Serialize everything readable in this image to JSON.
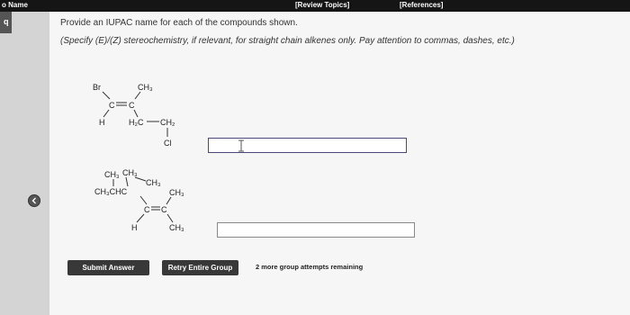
{
  "topbar": {
    "name_label": "o Name",
    "review_topics": "[Review Topics]",
    "references": "[References]"
  },
  "sidebar": {
    "question_tab": "q"
  },
  "instructions": {
    "line1": "Provide an IUPAC name for each of the compounds shown.",
    "line2": "(Specify (E)/(Z) stereochemistry, if relevant, for straight chain alkenes only. Pay attention to commas, dashes, etc.)"
  },
  "compound1": {
    "br": "Br",
    "ch3": "CH₃",
    "c_left": "C",
    "c_right": "C",
    "h": "H",
    "h2c": "H₂C",
    "ch2": "CH₂",
    "cl": "Cl"
  },
  "compound2": {
    "ch3_a": "CH₃",
    "ch3_b": "CH₃",
    "ch3_c": "CH₃",
    "ch3che": "CH₃CHC",
    "ch3_right": "CH₃",
    "c_left": "C",
    "c_right": "C",
    "h": "H",
    "ch3_bottom": "CH₃"
  },
  "answers": {
    "answer1_value": "",
    "answer2_value": ""
  },
  "actions": {
    "submit_label": "Submit Answer",
    "retry_label": "Retry Entire Group",
    "attempts_text": "2 more group attempts remaining"
  }
}
